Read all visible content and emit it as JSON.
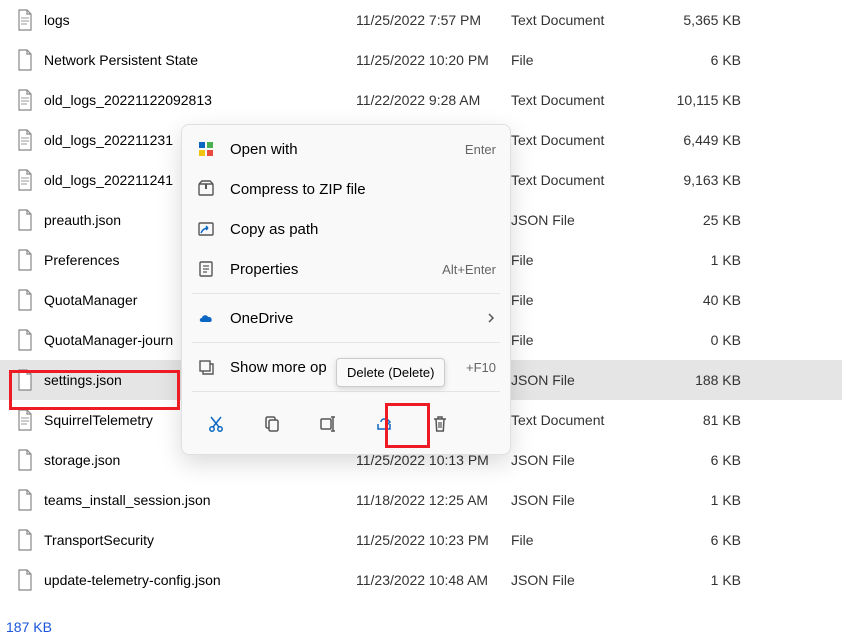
{
  "files": [
    {
      "name": "logs",
      "date": "11/25/2022 7:57 PM",
      "type": "Text Document",
      "size": "5,365 KB",
      "icon": "text",
      "selected": false
    },
    {
      "name": "Network Persistent State",
      "date": "11/25/2022 10:20 PM",
      "type": "File",
      "size": "6 KB",
      "icon": "file",
      "selected": false
    },
    {
      "name": "old_logs_20221122092813",
      "date": "11/22/2022 9:28 AM",
      "type": "Text Document",
      "size": "10,115 KB",
      "icon": "text",
      "selected": false
    },
    {
      "name": "old_logs_202211231",
      "date": "",
      "type": "Text Document",
      "size": "6,449 KB",
      "icon": "text",
      "selected": false
    },
    {
      "name": "old_logs_202211241",
      "date": "",
      "type": "Text Document",
      "size": "9,163 KB",
      "icon": "text",
      "selected": false
    },
    {
      "name": "preauth.json",
      "date": "",
      "type": "JSON File",
      "size": "25 KB",
      "icon": "file",
      "selected": false
    },
    {
      "name": "Preferences",
      "date": "",
      "type": "File",
      "size": "1 KB",
      "icon": "file",
      "selected": false
    },
    {
      "name": "QuotaManager",
      "date": "",
      "type": "File",
      "size": "40 KB",
      "icon": "file",
      "selected": false
    },
    {
      "name": "QuotaManager-journ",
      "date": "",
      "type": "File",
      "size": "0 KB",
      "icon": "file",
      "selected": false
    },
    {
      "name": "settings.json",
      "date": "",
      "type": "JSON File",
      "size": "188 KB",
      "icon": "file",
      "selected": true
    },
    {
      "name": "SquirrelTelemetry",
      "date": "",
      "type": "Text Document",
      "size": "81 KB",
      "icon": "text",
      "selected": false
    },
    {
      "name": "storage.json",
      "date": "11/25/2022 10:13 PM",
      "type": "JSON File",
      "size": "6 KB",
      "icon": "file",
      "selected": false
    },
    {
      "name": "teams_install_session.json",
      "date": "11/18/2022 12:25 AM",
      "type": "JSON File",
      "size": "1 KB",
      "icon": "file",
      "selected": false
    },
    {
      "name": "TransportSecurity",
      "date": "11/25/2022 10:23 PM",
      "type": "File",
      "size": "6 KB",
      "icon": "file",
      "selected": false
    },
    {
      "name": "update-telemetry-config.json",
      "date": "11/23/2022 10:48 AM",
      "type": "JSON File",
      "size": "1 KB",
      "icon": "file",
      "selected": false
    }
  ],
  "menu": {
    "open_with": "Open with",
    "open_with_shortcut": "Enter",
    "compress": "Compress to ZIP file",
    "copy_path": "Copy as path",
    "properties": "Properties",
    "properties_shortcut": "Alt+Enter",
    "onedrive": "OneDrive",
    "show_more": "Show more op",
    "show_more_shortcut": "+F10"
  },
  "tooltip": "Delete (Delete)",
  "status": "187 KB"
}
